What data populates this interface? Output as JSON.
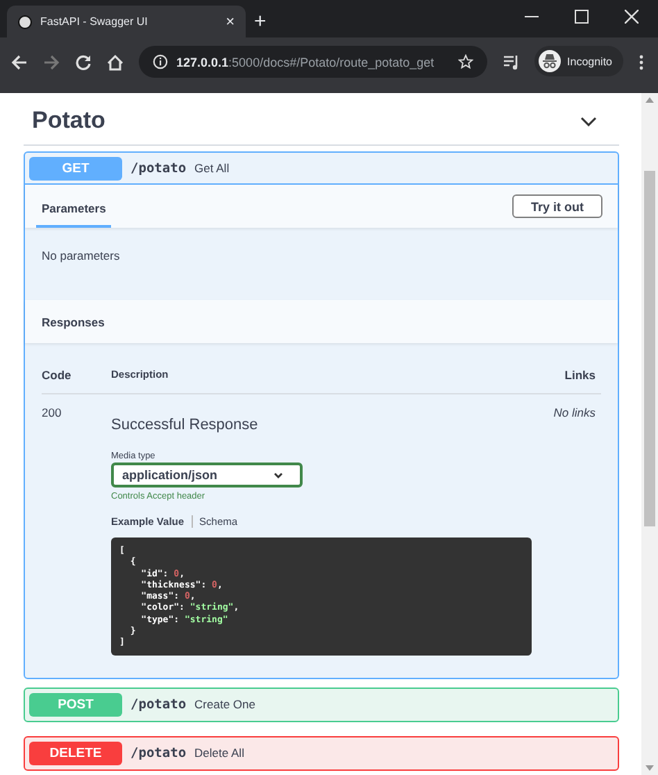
{
  "browser": {
    "tab_title": "FastAPI - Swagger UI",
    "tab_close": "×",
    "new_tab": "+",
    "host": "127.0.0.1",
    "path": ":5000/docs#/Potato/route_potato_get",
    "profile": "Incognito"
  },
  "section": {
    "title": "Potato",
    "expanded": true
  },
  "operations": [
    {
      "method": "GET",
      "path": "/potato",
      "summary": "Get All",
      "expanded": true,
      "tabs": [
        {
          "label": "Parameters",
          "selected": true
        }
      ],
      "try_button": "Try it out",
      "parameters_text": "No parameters",
      "responses_title": "Responses",
      "columns": [
        "Code",
        "Description",
        "Links"
      ],
      "responses": [
        {
          "code": "200",
          "description": "Successful Response",
          "links": "No links",
          "media_label": "Media type",
          "media_value": "application/json",
          "media_note": "Controls Accept header",
          "example_tabs": [
            {
              "label": "Example Value",
              "selected": true
            },
            {
              "label": "Schema",
              "selected": false
            }
          ],
          "example_lines": [
            [
              {
                "kind": "punct",
                "text": "["
              }
            ],
            [
              {
                "kind": "punct",
                "text": "  {"
              }
            ],
            [
              {
                "kind": "key",
                "text": "    \"id\": "
              },
              {
                "kind": "number",
                "text": "0"
              },
              {
                "kind": "punct",
                "text": ","
              }
            ],
            [
              {
                "kind": "key",
                "text": "    \"thickness\": "
              },
              {
                "kind": "number",
                "text": "0"
              },
              {
                "kind": "punct",
                "text": ","
              }
            ],
            [
              {
                "kind": "key",
                "text": "    \"mass\": "
              },
              {
                "kind": "number",
                "text": "0"
              },
              {
                "kind": "punct",
                "text": ","
              }
            ],
            [
              {
                "kind": "key",
                "text": "    \"color\": "
              },
              {
                "kind": "string",
                "text": "\"string\""
              },
              {
                "kind": "punct",
                "text": ","
              }
            ],
            [
              {
                "kind": "key",
                "text": "    \"type\": "
              },
              {
                "kind": "string",
                "text": "\"string\""
              }
            ],
            [
              {
                "kind": "punct",
                "text": "  }"
              }
            ],
            [
              {
                "kind": "punct",
                "text": "]"
              }
            ]
          ]
        }
      ]
    },
    {
      "method": "POST",
      "path": "/potato",
      "summary": "Create One",
      "expanded": false
    },
    {
      "method": "DELETE",
      "path": "/potato",
      "summary": "Delete All",
      "expanded": false
    }
  ]
}
